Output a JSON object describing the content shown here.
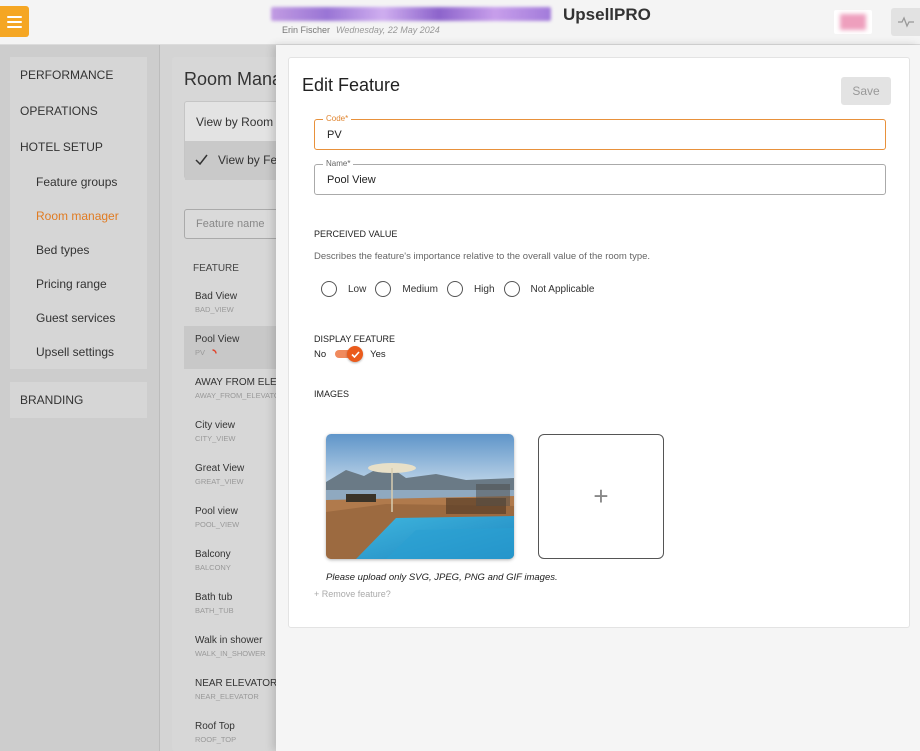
{
  "header": {
    "app_title": "UpsellPRO",
    "user_name": "Erin Fischer",
    "date": "Wednesday, 22 May 2024"
  },
  "sidebar": {
    "sections": [
      {
        "label": "PERFORMANCE"
      },
      {
        "label": "OPERATIONS"
      },
      {
        "label": "HOTEL SETUP",
        "items": [
          "Feature groups",
          "Room manager",
          "Bed types",
          "Pricing range",
          "Guest services",
          "Upsell settings"
        ]
      },
      {
        "label": "BRANDING"
      }
    ],
    "active_item": "Room manager"
  },
  "room_manager": {
    "title": "Room Manager",
    "view_by_room": "View by Room",
    "view_by_feature": "View by Feature",
    "search_placeholder": "Feature name",
    "column_header": "FEATURE",
    "features": [
      {
        "name": "Bad View",
        "code": "BAD_VIEW"
      },
      {
        "name": "Pool View",
        "code": "PV"
      },
      {
        "name": "AWAY FROM ELEVATOR",
        "code": "AWAY_FROM_ELEVATOR"
      },
      {
        "name": "City view",
        "code": "CITY_VIEW"
      },
      {
        "name": "Great View",
        "code": "GREAT_VIEW"
      },
      {
        "name": "Pool view",
        "code": "POOL_VIEW"
      },
      {
        "name": "Balcony",
        "code": "BALCONY"
      },
      {
        "name": "Bath tub",
        "code": "BATH_TUB"
      },
      {
        "name": "Walk in shower",
        "code": "WALK_IN_SHOWER"
      },
      {
        "name": "NEAR ELEVATOR",
        "code": "NEAR_ELEVATOR"
      },
      {
        "name": "Roof Top",
        "code": "ROOF_TOP"
      }
    ]
  },
  "edit_feature": {
    "title": "Edit Feature",
    "save_label": "Save",
    "code_label": "Code*",
    "code_value": "PV",
    "name_label": "Name*",
    "name_value": "Pool View",
    "perceived_title": "PERCEIVED VALUE",
    "perceived_desc": "Describes the feature's importance relative to the overall value of the room type.",
    "perceived_options": [
      "Low",
      "Medium",
      "High",
      "Not Applicable"
    ],
    "display_title": "DISPLAY FEATURE",
    "display_no": "No",
    "display_yes": "Yes",
    "display_enabled": true,
    "images_title": "IMAGES",
    "add_image_symbol": "+",
    "upload_note": "Please upload only SVG, JPEG, PNG and GIF images.",
    "remove_link": "+ Remove feature?"
  },
  "colors": {
    "accent_orange": "#e8913b",
    "toggle_orange": "#ea5b1c",
    "menu_button": "#f5a623"
  }
}
